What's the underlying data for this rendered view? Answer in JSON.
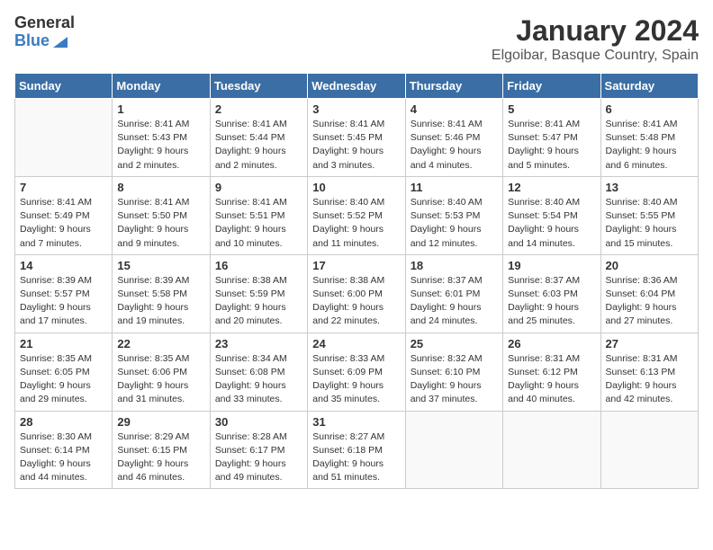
{
  "logo": {
    "general": "General",
    "blue": "Blue"
  },
  "title": "January 2024",
  "subtitle": "Elgoibar, Basque Country, Spain",
  "headers": [
    "Sunday",
    "Monday",
    "Tuesday",
    "Wednesday",
    "Thursday",
    "Friday",
    "Saturday"
  ],
  "weeks": [
    [
      {
        "day": "",
        "info": ""
      },
      {
        "day": "1",
        "info": "Sunrise: 8:41 AM\nSunset: 5:43 PM\nDaylight: 9 hours\nand 2 minutes."
      },
      {
        "day": "2",
        "info": "Sunrise: 8:41 AM\nSunset: 5:44 PM\nDaylight: 9 hours\nand 2 minutes."
      },
      {
        "day": "3",
        "info": "Sunrise: 8:41 AM\nSunset: 5:45 PM\nDaylight: 9 hours\nand 3 minutes."
      },
      {
        "day": "4",
        "info": "Sunrise: 8:41 AM\nSunset: 5:46 PM\nDaylight: 9 hours\nand 4 minutes."
      },
      {
        "day": "5",
        "info": "Sunrise: 8:41 AM\nSunset: 5:47 PM\nDaylight: 9 hours\nand 5 minutes."
      },
      {
        "day": "6",
        "info": "Sunrise: 8:41 AM\nSunset: 5:48 PM\nDaylight: 9 hours\nand 6 minutes."
      }
    ],
    [
      {
        "day": "7",
        "info": "Sunrise: 8:41 AM\nSunset: 5:49 PM\nDaylight: 9 hours\nand 7 minutes."
      },
      {
        "day": "8",
        "info": "Sunrise: 8:41 AM\nSunset: 5:50 PM\nDaylight: 9 hours\nand 9 minutes."
      },
      {
        "day": "9",
        "info": "Sunrise: 8:41 AM\nSunset: 5:51 PM\nDaylight: 9 hours\nand 10 minutes."
      },
      {
        "day": "10",
        "info": "Sunrise: 8:40 AM\nSunset: 5:52 PM\nDaylight: 9 hours\nand 11 minutes."
      },
      {
        "day": "11",
        "info": "Sunrise: 8:40 AM\nSunset: 5:53 PM\nDaylight: 9 hours\nand 12 minutes."
      },
      {
        "day": "12",
        "info": "Sunrise: 8:40 AM\nSunset: 5:54 PM\nDaylight: 9 hours\nand 14 minutes."
      },
      {
        "day": "13",
        "info": "Sunrise: 8:40 AM\nSunset: 5:55 PM\nDaylight: 9 hours\nand 15 minutes."
      }
    ],
    [
      {
        "day": "14",
        "info": "Sunrise: 8:39 AM\nSunset: 5:57 PM\nDaylight: 9 hours\nand 17 minutes."
      },
      {
        "day": "15",
        "info": "Sunrise: 8:39 AM\nSunset: 5:58 PM\nDaylight: 9 hours\nand 19 minutes."
      },
      {
        "day": "16",
        "info": "Sunrise: 8:38 AM\nSunset: 5:59 PM\nDaylight: 9 hours\nand 20 minutes."
      },
      {
        "day": "17",
        "info": "Sunrise: 8:38 AM\nSunset: 6:00 PM\nDaylight: 9 hours\nand 22 minutes."
      },
      {
        "day": "18",
        "info": "Sunrise: 8:37 AM\nSunset: 6:01 PM\nDaylight: 9 hours\nand 24 minutes."
      },
      {
        "day": "19",
        "info": "Sunrise: 8:37 AM\nSunset: 6:03 PM\nDaylight: 9 hours\nand 25 minutes."
      },
      {
        "day": "20",
        "info": "Sunrise: 8:36 AM\nSunset: 6:04 PM\nDaylight: 9 hours\nand 27 minutes."
      }
    ],
    [
      {
        "day": "21",
        "info": "Sunrise: 8:35 AM\nSunset: 6:05 PM\nDaylight: 9 hours\nand 29 minutes."
      },
      {
        "day": "22",
        "info": "Sunrise: 8:35 AM\nSunset: 6:06 PM\nDaylight: 9 hours\nand 31 minutes."
      },
      {
        "day": "23",
        "info": "Sunrise: 8:34 AM\nSunset: 6:08 PM\nDaylight: 9 hours\nand 33 minutes."
      },
      {
        "day": "24",
        "info": "Sunrise: 8:33 AM\nSunset: 6:09 PM\nDaylight: 9 hours\nand 35 minutes."
      },
      {
        "day": "25",
        "info": "Sunrise: 8:32 AM\nSunset: 6:10 PM\nDaylight: 9 hours\nand 37 minutes."
      },
      {
        "day": "26",
        "info": "Sunrise: 8:31 AM\nSunset: 6:12 PM\nDaylight: 9 hours\nand 40 minutes."
      },
      {
        "day": "27",
        "info": "Sunrise: 8:31 AM\nSunset: 6:13 PM\nDaylight: 9 hours\nand 42 minutes."
      }
    ],
    [
      {
        "day": "28",
        "info": "Sunrise: 8:30 AM\nSunset: 6:14 PM\nDaylight: 9 hours\nand 44 minutes."
      },
      {
        "day": "29",
        "info": "Sunrise: 8:29 AM\nSunset: 6:15 PM\nDaylight: 9 hours\nand 46 minutes."
      },
      {
        "day": "30",
        "info": "Sunrise: 8:28 AM\nSunset: 6:17 PM\nDaylight: 9 hours\nand 49 minutes."
      },
      {
        "day": "31",
        "info": "Sunrise: 8:27 AM\nSunset: 6:18 PM\nDaylight: 9 hours\nand 51 minutes."
      },
      {
        "day": "",
        "info": ""
      },
      {
        "day": "",
        "info": ""
      },
      {
        "day": "",
        "info": ""
      }
    ]
  ]
}
